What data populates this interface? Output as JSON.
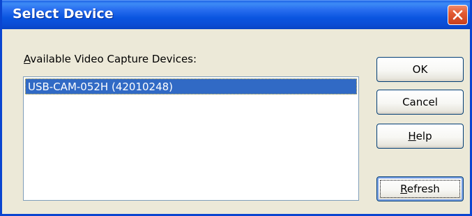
{
  "window": {
    "title": "Select Device"
  },
  "devices": {
    "label_mnemonic": "A",
    "label_rest": "vailable Video Capture Devices:",
    "items": [
      {
        "label": "USB-CAM-052H (42010248)",
        "selected": true
      }
    ]
  },
  "buttons": {
    "ok": "OK",
    "cancel": "Cancel",
    "help_mnemonic": "H",
    "help_rest": "elp",
    "refresh_mnemonic": "R",
    "refresh_rest": "efresh"
  },
  "icons": {
    "close": "close-icon"
  },
  "colors": {
    "title_bar": "#0a55e0",
    "dialog_background": "#ece9d8",
    "selection": "#316ac5",
    "close_button": "#e35b32"
  }
}
